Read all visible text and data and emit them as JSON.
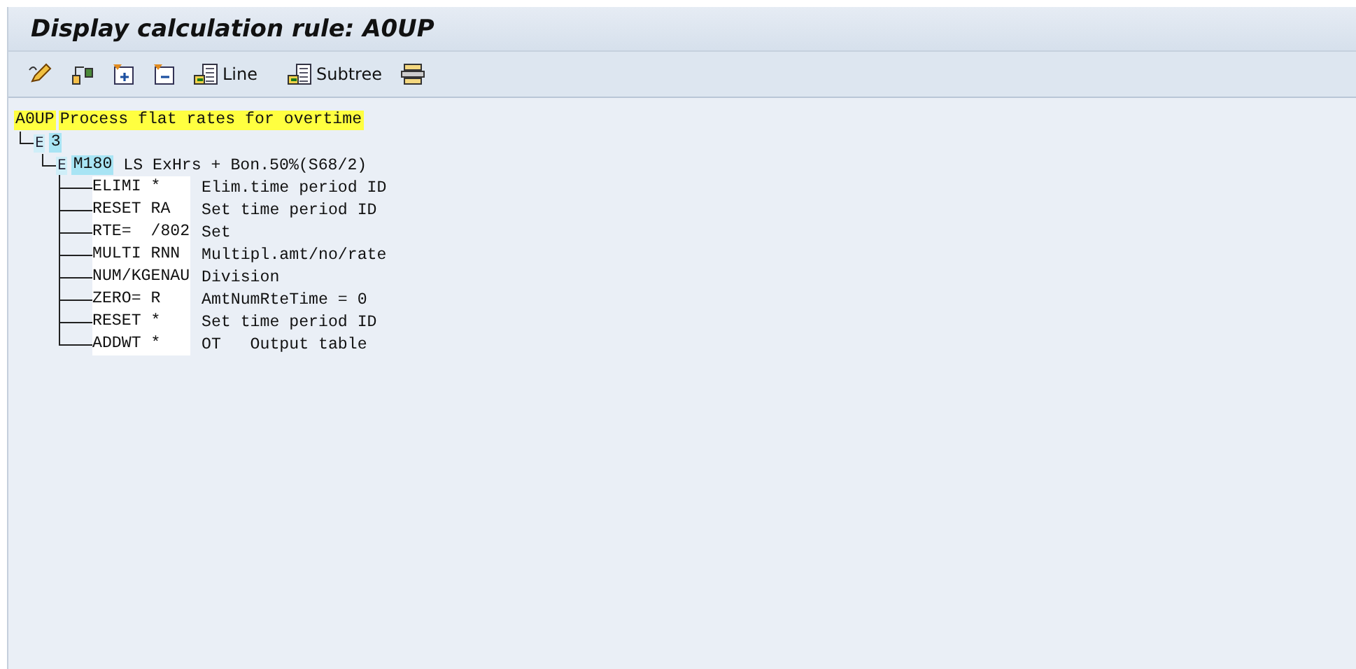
{
  "title": "Display calculation rule: A0UP",
  "toolbar": {
    "labeled_buttons": [
      {
        "label": "Line"
      },
      {
        "label": "Subtree"
      }
    ]
  },
  "rule": {
    "code": "A0UP",
    "text": "Process flat rates for overtime",
    "children": [
      {
        "type": "E",
        "label": "3",
        "children": [
          {
            "type": "E",
            "label": "M180",
            "text": "LS ExHrs + Bon.50%(S68/2)",
            "operations": [
              {
                "operation": "ELIMI *",
                "text": "Elim.time period ID"
              },
              {
                "operation": "RESET RA",
                "text": "Set time period ID"
              },
              {
                "operation": "RTE=  /802",
                "text": "Set"
              },
              {
                "operation": "MULTI RNN",
                "text": "Multipl.amt/no/rate"
              },
              {
                "operation": "NUM/KGENAU",
                "text": "Division"
              },
              {
                "operation": "ZERO= R",
                "text": "AmtNumRteTime = 0"
              },
              {
                "operation": "RESET *",
                "text": "Set time period ID"
              },
              {
                "operation": "ADDWT *",
                "text": "OT   Output table"
              }
            ]
          }
        ]
      }
    ]
  }
}
